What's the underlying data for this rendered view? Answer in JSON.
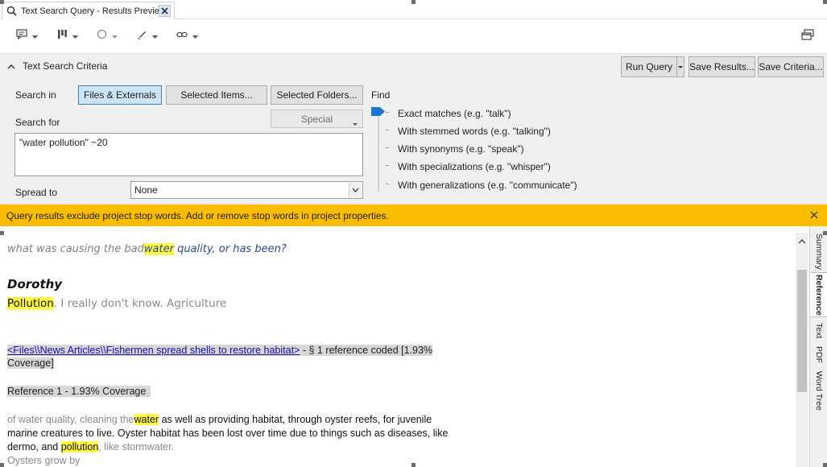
{
  "tab": {
    "title": "Text Search Query - Results Preview"
  },
  "icons": {
    "tab": "search-icon",
    "close": "close-icon",
    "toolbar": [
      "comment-icon",
      "bars-icon",
      "circle-icon",
      "highlighter-icon",
      "link-icon"
    ],
    "restore": "window-restore-icon",
    "collapse": "chevron-up-icon"
  },
  "criteria": {
    "title": "Text Search Criteria",
    "run_query": "Run Query",
    "save_results": "Save Results...",
    "save_criteria": "Save Criteria...",
    "search_in_label": "Search in",
    "search_in_options": [
      "Files & Externals",
      "Selected Items...",
      "Selected Folders..."
    ],
    "search_for_label": "Search for",
    "special_label": "Special",
    "query_text": "\"water pollution\" ~20",
    "spread_to_label": "Spread to",
    "spread_to_value": "None",
    "find_label": "Find",
    "find_options": [
      "Exact matches (e.g. \"talk\")",
      "With stemmed words (e.g. \"talking\")",
      "With synonyms (e.g. \"speak\")",
      "With specializations (e.g. \"whisper\")",
      "With generalizations (e.g. \"communicate\")"
    ]
  },
  "infobar": {
    "message": "Query results exclude project stop words. Add or remove stop words in project properties."
  },
  "results": {
    "question_pre": "what was causing the bad",
    "question_hit": "water",
    "question_post": "quality, or has been?",
    "speaker": "Dorothy",
    "answer_hit": "Pollution",
    "answer_post": ". I really don't know. Agriculture",
    "ref_link": "<Files\\\\News Articles\\\\Fishermen spread shells to restore habitat>",
    "ref_summary": " - § 1 reference coded  [1.93%",
    "ref_coverage": "Coverage]",
    "ref_heading": "Reference 1 - 1.93% Coverage",
    "body_grey_1": "of water quality, cleaning the",
    "body_hit_1": "water",
    "body_1": "as well as providing habitat, through oyster reefs, for juvenile marine creatures to live. Oyster habitat has been lost over time due to things such as diseases, like dermo, and",
    "body_hit_2": "pollution",
    "body_grey_2": ", like stormwater.",
    "body_grey_3": "Oysters grow by"
  },
  "side_tabs": [
    "Summary",
    "Reference",
    "Text",
    "PDF",
    "Word Tree"
  ]
}
